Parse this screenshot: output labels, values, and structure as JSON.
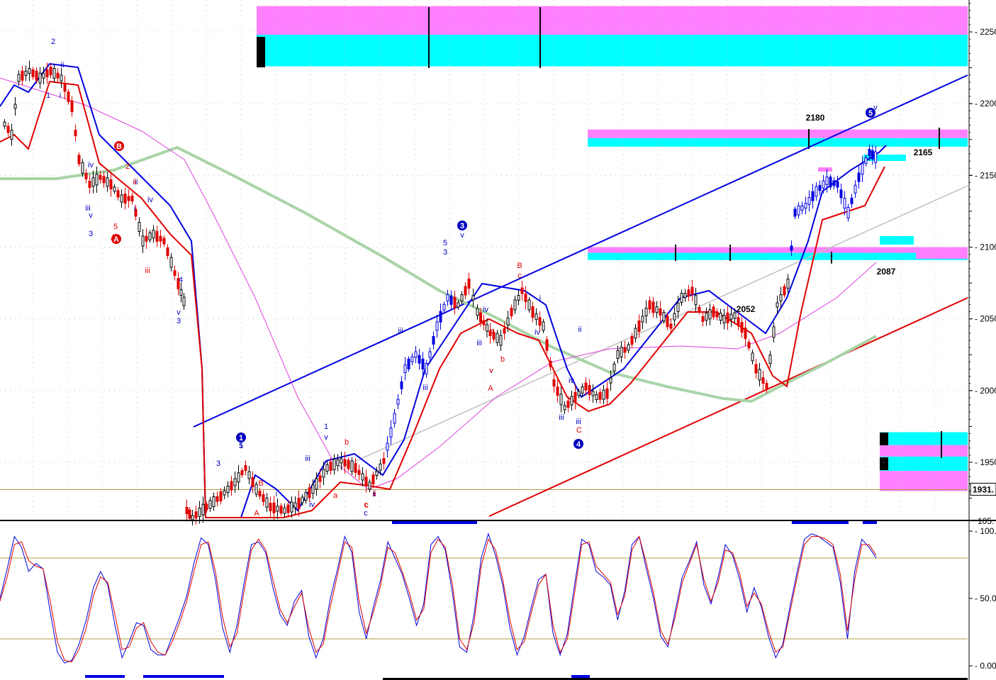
{
  "chart_data": [
    {
      "type": "candlestick",
      "panel": "price",
      "grid": "dotted",
      "y_axis_position": "right",
      "ylim": [
        1915,
        2272
      ],
      "y_ticks": [
        {
          "value": 2250,
          "label": "2250"
        },
        {
          "value": 2200,
          "label": "2200"
        },
        {
          "value": 2150,
          "label": "2150"
        },
        {
          "value": 2100,
          "label": "2100"
        },
        {
          "value": 2050,
          "label": "2050"
        },
        {
          "value": 2000,
          "label": "2000"
        },
        {
          "value": 1950,
          "label": "1950"
        }
      ],
      "last_price_label": "1931.",
      "reference_level": 1931,
      "price_annotations": [
        {
          "text": "2180",
          "value": 2180
        },
        {
          "text": "2165",
          "value": 2165
        },
        {
          "text": "2087",
          "value": 2087
        },
        {
          "text": "2052",
          "value": 2052
        }
      ],
      "wave_labels_blue": [
        "2",
        "ii",
        "1",
        "i",
        "3",
        "v",
        "iii",
        "iv",
        "ii",
        "i",
        "iv",
        "4",
        "v",
        "3",
        "1",
        "5",
        "3",
        "iii",
        "v",
        "1",
        "i",
        "iv",
        "i",
        "iii",
        "ii",
        "c",
        "3",
        "v",
        "5",
        "iii",
        "iv",
        "iii",
        "iv",
        "ii",
        "i",
        "iv",
        "iii",
        "v",
        "iii",
        "v",
        "5"
      ],
      "wave_labels_red": [
        "B",
        "2",
        "ii",
        "A",
        "5",
        "iii",
        "a",
        "b",
        "c",
        "B",
        "c",
        "A",
        "v",
        "b",
        "C",
        "B",
        "a",
        "A",
        "c",
        "ii"
      ],
      "circled_labels_red": [
        "B",
        "A"
      ],
      "circled_labels_blue": [
        "1",
        "3",
        "4",
        "5"
      ],
      "series_colors": {
        "upper_band": "#0000e0",
        "lower_band": "#e00000",
        "long_ma": "#a8d4a8",
        "magenta_ma": "#e040e0",
        "channel_upper": "#0000e0",
        "channel_lower": "#e00000",
        "channel_mid": "#c0c0c0",
        "zone_magenta": "#ff80ff",
        "zone_cyan": "#00ffff"
      },
      "zones": [
        {
          "y_top": 2268,
          "y_bottom": 2248,
          "color": "#ff80ff"
        },
        {
          "y_top": 2248,
          "y_bottom": 2226,
          "color": "#00ffff"
        },
        {
          "y_top": 2182,
          "y_bottom": 2176,
          "color": "#ff80ff"
        },
        {
          "y_top": 2176,
          "y_bottom": 2170,
          "color": "#00ffff"
        },
        {
          "y_top": 2100,
          "y_bottom": 2096,
          "color": "#ff80ff"
        },
        {
          "y_top": 2096,
          "y_bottom": 2091,
          "color": "#00ffff"
        },
        {
          "y_top": 1971,
          "y_bottom": 1962,
          "color": "#00ffff"
        },
        {
          "y_top": 1962,
          "y_bottom": 1954,
          "color": "#ff80ff"
        },
        {
          "y_top": 1954,
          "y_bottom": 1944,
          "color": "#00ffff"
        },
        {
          "y_top": 1944,
          "y_bottom": 1930,
          "color": "#ff80ff"
        }
      ]
    },
    {
      "type": "line",
      "panel": "oscillator",
      "ylim": [
        -5,
        105
      ],
      "y_ticks": [
        {
          "value": 100,
          "label": "100.0"
        },
        {
          "value": 50,
          "label": "50.00"
        },
        {
          "value": 0,
          "label": "0.00"
        }
      ],
      "top_partial_label": "105.",
      "reference_lines": [
        80,
        20
      ],
      "series": [
        {
          "color": "#0000e0",
          "values": [
            50,
            72,
            96,
            88,
            70,
            76,
            72,
            40,
            10,
            2,
            4,
            16,
            34,
            58,
            70,
            60,
            30,
            6,
            18,
            32,
            30,
            12,
            8,
            8,
            22,
            36,
            52,
            76,
            95,
            90,
            64,
            28,
            10,
            30,
            62,
            90,
            92,
            84,
            58,
            38,
            30,
            48,
            56,
            22,
            6,
            20,
            50,
            72,
            96,
            84,
            40,
            20,
            44,
            64,
            92,
            80,
            68,
            50,
            30,
            46,
            90,
            96,
            86,
            54,
            14,
            10,
            38,
            80,
            98,
            82,
            60,
            28,
            8,
            22,
            44,
            64,
            68,
            24,
            8,
            24,
            60,
            94,
            90,
            70,
            66,
            60,
            34,
            56,
            90,
            96,
            72,
            50,
            22,
            14,
            40,
            66,
            78,
            92,
            60,
            46,
            66,
            90,
            82,
            64,
            40,
            58,
            44,
            22,
            6,
            16,
            44,
            70,
            94,
            98,
            96,
            92,
            88,
            62,
            20,
            70,
            94,
            88,
            80
          ]
        },
        {
          "color": "#e00000",
          "values": [
            48,
            66,
            90,
            92,
            78,
            74,
            72,
            48,
            18,
            4,
            3,
            12,
            28,
            52,
            66,
            62,
            38,
            12,
            14,
            28,
            32,
            18,
            10,
            8,
            18,
            32,
            48,
            70,
            90,
            92,
            70,
            36,
            14,
            24,
            56,
            86,
            94,
            86,
            64,
            42,
            32,
            44,
            54,
            28,
            10,
            16,
            44,
            68,
            92,
            88,
            48,
            24,
            40,
            60,
            88,
            84,
            70,
            54,
            34,
            42,
            84,
            94,
            88,
            60,
            20,
            12,
            32,
            74,
            94,
            86,
            64,
            34,
            12,
            18,
            40,
            60,
            68,
            30,
            10,
            20,
            54,
            90,
            92,
            74,
            68,
            62,
            38,
            52,
            86,
            96,
            76,
            54,
            26,
            16,
            36,
            62,
            76,
            90,
            64,
            48,
            62,
            86,
            84,
            68,
            44,
            54,
            46,
            26,
            10,
            14,
            40,
            66,
            90,
            96,
            96,
            94,
            90,
            68,
            26,
            64,
            90,
            90,
            82
          ]
        }
      ],
      "signal_bars_bottom": 3,
      "signal_bars_top": 3
    }
  ]
}
